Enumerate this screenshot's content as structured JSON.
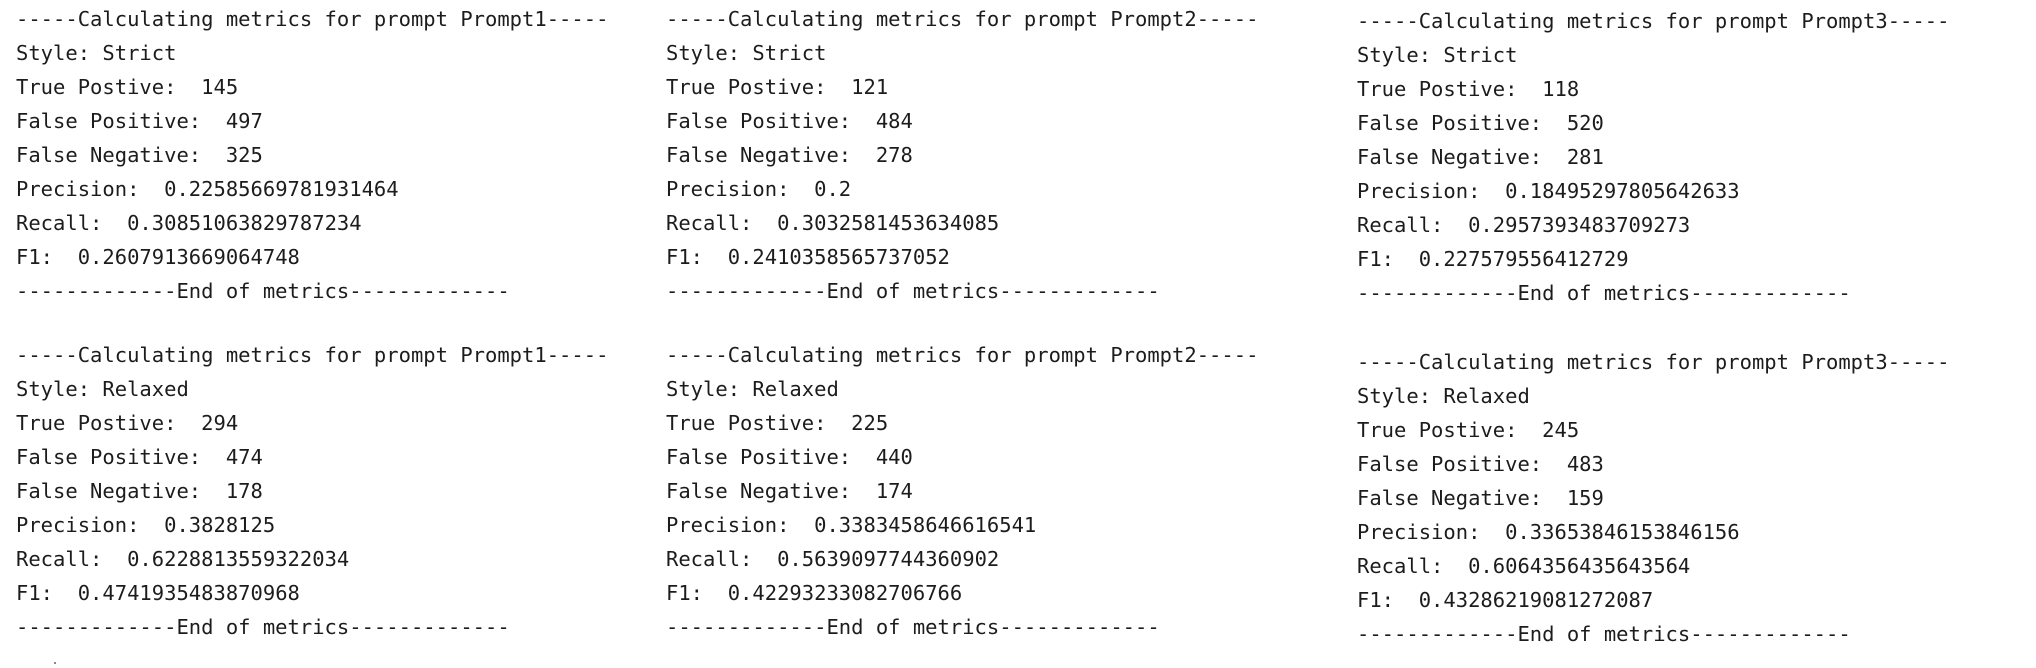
{
  "blocks": [
    {
      "header": "-----Calculating metrics for prompt Prompt1-----",
      "style_label": "Style: ",
      "style_value": "Strict",
      "tp_label": "True Postive:  ",
      "tp_value": "145",
      "fp_label": "False Positive:  ",
      "fp_value": "497",
      "fn_label": "False Negative:  ",
      "fn_value": "325",
      "precision_label": "Precision:  ",
      "precision_value": "0.22585669781931464",
      "recall_label": "Recall:  ",
      "recall_value": "0.30851063829787234",
      "f1_label": "F1:  ",
      "f1_value": "0.2607913669064748",
      "footer": "-------------End of metrics-------------"
    },
    {
      "header": "-----Calculating metrics for prompt Prompt2-----",
      "style_label": "Style: ",
      "style_value": "Strict",
      "tp_label": "True Postive:  ",
      "tp_value": "121",
      "fp_label": "False Positive:  ",
      "fp_value": "484",
      "fn_label": "False Negative:  ",
      "fn_value": "278",
      "precision_label": "Precision:  ",
      "precision_value": "0.2",
      "recall_label": "Recall:  ",
      "recall_value": "0.3032581453634085",
      "f1_label": "F1:  ",
      "f1_value": "0.2410358565737052",
      "footer": "-------------End of metrics-------------"
    },
    {
      "header": "-----Calculating metrics for prompt Prompt3-----",
      "style_label": "Style: ",
      "style_value": "Strict",
      "tp_label": "True Postive:  ",
      "tp_value": "118",
      "fp_label": "False Positive:  ",
      "fp_value": "520",
      "fn_label": "False Negative:  ",
      "fn_value": "281",
      "precision_label": "Precision:  ",
      "precision_value": "0.18495297805642633",
      "recall_label": "Recall:  ",
      "recall_value": "0.2957393483709273",
      "f1_label": "F1:  ",
      "f1_value": "0.227579556412729",
      "footer": "-------------End of metrics-------------"
    },
    {
      "header": "-----Calculating metrics for prompt Prompt1-----",
      "style_label": "Style: ",
      "style_value": "Relaxed",
      "tp_label": "True Postive:  ",
      "tp_value": "294",
      "fp_label": "False Positive:  ",
      "fp_value": "474",
      "fn_label": "False Negative:  ",
      "fn_value": "178",
      "precision_label": "Precision:  ",
      "precision_value": "0.3828125",
      "recall_label": "Recall:  ",
      "recall_value": "0.6228813559322034",
      "f1_label": "F1:  ",
      "f1_value": "0.4741935483870968",
      "footer": "-------------End of metrics-------------"
    },
    {
      "header": "-----Calculating metrics for prompt Prompt2-----",
      "style_label": "Style: ",
      "style_value": "Relaxed",
      "tp_label": "True Postive:  ",
      "tp_value": "225",
      "fp_label": "False Positive:  ",
      "fp_value": "440",
      "fn_label": "False Negative:  ",
      "fn_value": "174",
      "precision_label": "Precision:  ",
      "precision_value": "0.3383458646616541",
      "recall_label": "Recall:  ",
      "recall_value": "0.5639097744360902",
      "f1_label": "F1:  ",
      "f1_value": "0.42293233082706766",
      "footer": "-------------End of metrics-------------"
    },
    {
      "header": "-----Calculating metrics for prompt Prompt3-----",
      "style_label": "Style: ",
      "style_value": "Relaxed",
      "tp_label": "True Postive:  ",
      "tp_value": "245",
      "fp_label": "False Positive:  ",
      "fp_value": "483",
      "fn_label": "False Negative:  ",
      "fn_value": "159",
      "precision_label": "Precision:  ",
      "precision_value": "0.33653846153846156",
      "recall_label": "Recall:  ",
      "recall_value": "0.6064356435643564",
      "f1_label": "F1:  ",
      "f1_value": "0.43286219081272087",
      "footer": "-------------End of metrics-------------"
    }
  ]
}
